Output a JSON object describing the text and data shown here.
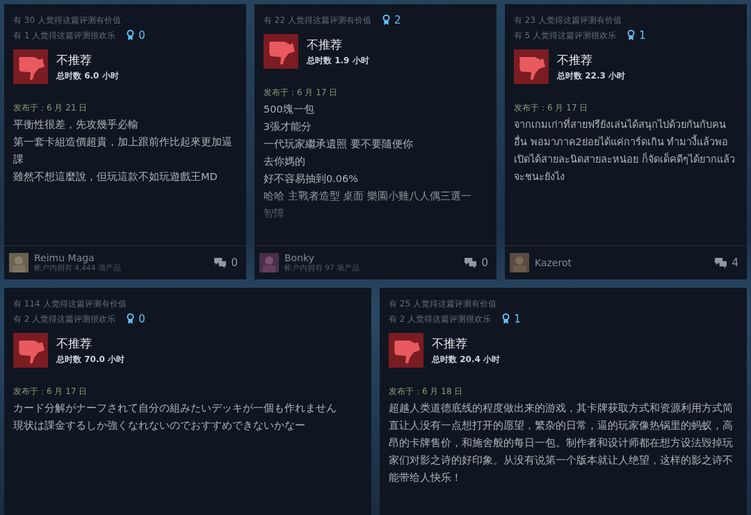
{
  "top_reviews": [
    {
      "helpful": [
        "有 30 人觉得这篇评测有价值",
        "有 1 人觉得这篇评测很欢乐"
      ],
      "awards": "0",
      "verdict": "不推荐",
      "hours": "总时数 6.0 小时",
      "posted": "发布于：6 月 21 日",
      "body": [
        "平衡性很差，先攻幾乎必輸",
        "第一套卡組造價超貴，加上跟前作比起來更加逼課",
        "雖然不想這麼說，但玩這款不如玩遊戲王MD"
      ],
      "faded": false,
      "author": {
        "name": "Reimu Maga",
        "products": "帐户内拥有 4,444 项产品",
        "kind": "picture"
      },
      "comments": "0"
    },
    {
      "helpful": [
        "有 22 人觉得这篇评测有价值"
      ],
      "awards": "2",
      "verdict": "不推荐",
      "hours": "总时数 1.9 小时",
      "posted": "发布于：6 月 17 日",
      "body": [
        "500塊一包",
        "3張才能分",
        "一代玩家繼承遺照 要不要隨便你",
        "去你媽的",
        "好不容易抽到0.06%",
        "哈哈 主戰者造型 桌面 樂園小雞八人偶三選一",
        "智障"
      ],
      "faded": true,
      "author": {
        "name": "Bonky",
        "products": "帐户内拥有 97 项产品",
        "kind": "picture"
      },
      "comments": "0"
    },
    {
      "helpful": [
        "有 23 人觉得这篇评测有价值",
        "有 5 人觉得这篇评测很欢乐"
      ],
      "awards": "1",
      "verdict": "不推荐",
      "hours": "总时数 22.3 小时",
      "posted": "发布于：6 月 17 日",
      "body": [
        "จากเกมเก่าที่สายฟรียังเล่นได้สนุกไปด้วยกันกับคนอื่น พอมาภาค2ย่อยได้แค่การ์ดเกิน ทำมางี้แล้วพอเปิดได้สายละนิดสายละหน่อย ก็จัดเด็คดีๆได้ยากแล้วจะชนะยังไง"
      ],
      "faded": false,
      "author": {
        "name": "Kazerot",
        "kind": "picture"
      },
      "comments": "4"
    }
  ],
  "bottom_reviews": [
    {
      "helpful": [
        "有 114 人觉得这篇评测有价值",
        "有 2 人觉得这篇评测很欢乐"
      ],
      "awards": "0",
      "verdict": "不推荐",
      "hours": "总时数 70.0 小时",
      "posted": "发布于：6 月 17 日",
      "body": [
        "カード分解がナーフされて自分の組みたいデッキが一個も作れません",
        "現状は課金するしか強くなれないのでおすすめできないかなー"
      ],
      "faded": false
    },
    {
      "helpful": [
        "有 25 人觉得这篇评测有价值",
        "有 2 人觉得这篇评测很欢乐"
      ],
      "awards": "1",
      "verdict": "不推荐",
      "hours": "总时数 20.4 小时",
      "posted": "发布于：6 月 18 日",
      "body": [
        "超越人类道德底线的程度做出来的游戏，其卡牌获取方式和资源利用方式简直让人没有一点想打开的愿望，繁杂的日常，逼的玩家像热锅里的蚂蚁，高昂的卡牌售价，和施舍般的每日一包。制作者和设计师都在想方设法毁掉玩家们对影之诗的好印象。从没有说第一个版本就让人绝望，这样的影之诗不能带给人快乐！"
      ],
      "faded": false
    }
  ]
}
